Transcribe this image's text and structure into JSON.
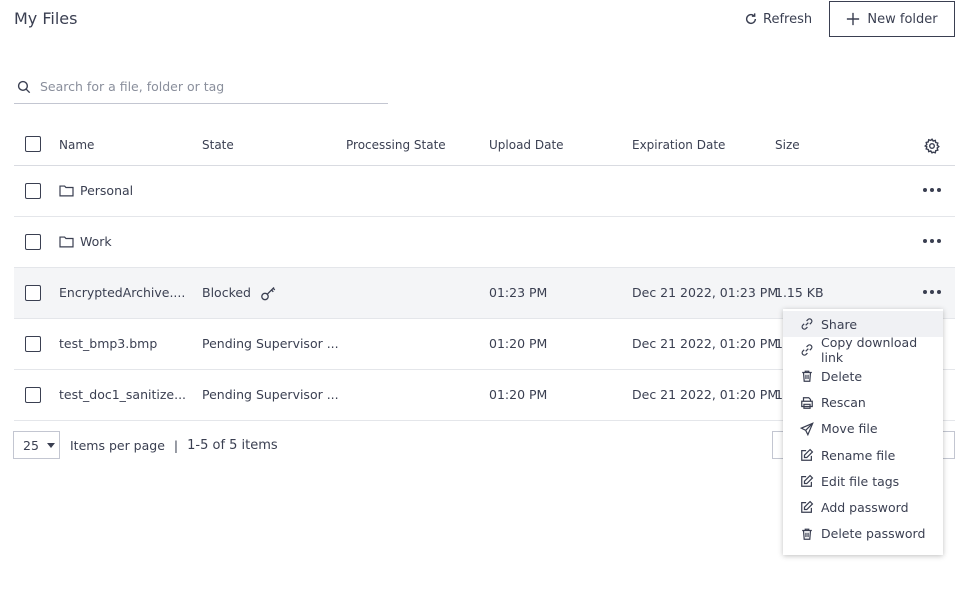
{
  "header": {
    "title": "My Files",
    "refresh_label": "Refresh",
    "new_folder_label": "New folder"
  },
  "search": {
    "placeholder": "Search for a file, folder or tag",
    "value": ""
  },
  "table": {
    "columns": [
      "Name",
      "State",
      "Processing State",
      "Upload Date",
      "Expiration Date",
      "Size"
    ],
    "rows": [
      {
        "type": "folder",
        "name": "Personal",
        "state": "",
        "processing_state": "",
        "upload_date": "",
        "expiration_date": "",
        "size": ""
      },
      {
        "type": "folder",
        "name": "Work",
        "state": "",
        "processing_state": "",
        "upload_date": "",
        "expiration_date": "",
        "size": ""
      },
      {
        "type": "file",
        "name": "EncryptedArchive....",
        "state": "Blocked",
        "processing_state": "",
        "upload_date": "01:23 PM",
        "expiration_date": "Dec 21 2022, 01:23 PM",
        "size": "1.15 KB"
      },
      {
        "type": "file",
        "name": "test_bmp3.bmp",
        "state": "Pending Supervisor ...",
        "processing_state": "",
        "upload_date": "01:20 PM",
        "expiration_date": "Dec 21 2022, 01:20 PM",
        "size": "1"
      },
      {
        "type": "file",
        "name": "test_doc1_sanitize...",
        "state": "Pending Supervisor ...",
        "processing_state": "",
        "upload_date": "01:20 PM",
        "expiration_date": "Dec 21 2022, 01:20 PM",
        "size": "1"
      }
    ]
  },
  "pager": {
    "per_page": "25",
    "per_page_label": "Items per page",
    "separator": "|",
    "range": "1-5 of 5 items"
  },
  "context_menu": {
    "items": [
      {
        "label": "Share",
        "icon": "link-icon"
      },
      {
        "label": "Copy download link",
        "icon": "link-icon"
      },
      {
        "label": "Delete",
        "icon": "trash-icon"
      },
      {
        "label": "Rescan",
        "icon": "printer-icon"
      },
      {
        "label": "Move file",
        "icon": "send-icon"
      },
      {
        "label": "Rename file",
        "icon": "edit-icon"
      },
      {
        "label": "Edit file tags",
        "icon": "edit-icon"
      },
      {
        "label": "Add password",
        "icon": "edit-icon"
      },
      {
        "label": "Delete password",
        "icon": "trash-icon"
      }
    ]
  },
  "colors": {
    "text": "#3a3f51",
    "blocked": "#c8102e",
    "border": "#c3c6d1",
    "row_highlight": "#f4f5f7"
  }
}
